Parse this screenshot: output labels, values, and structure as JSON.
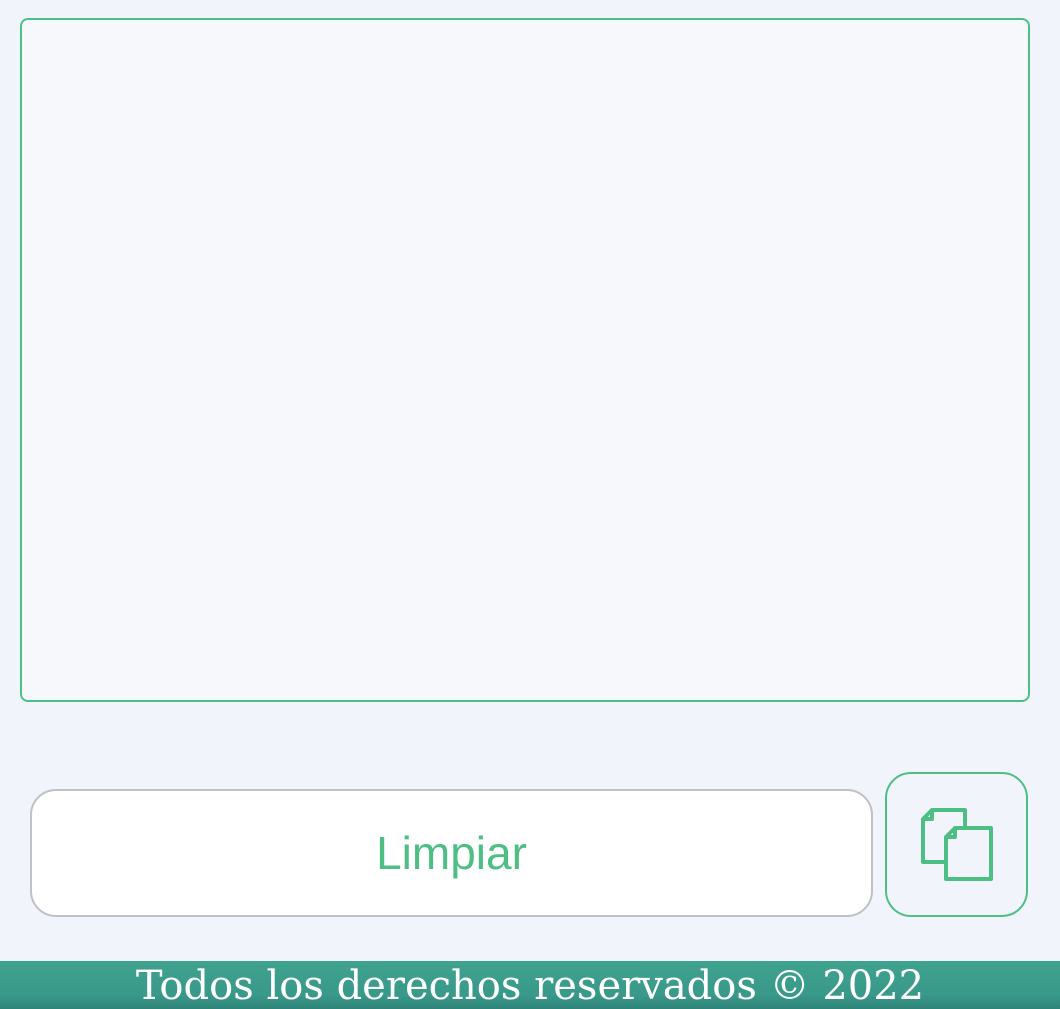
{
  "editor": {
    "value": "",
    "placeholder": ""
  },
  "actions": {
    "clear_label": "Limpiar",
    "copy_icon": "copy-icon"
  },
  "footer": {
    "text": "Todos los derechos reservados © 2022"
  },
  "colors": {
    "accent": "#4ebf84",
    "footer_bg": "#3fa28e",
    "page_bg": "#f1f5fb"
  }
}
